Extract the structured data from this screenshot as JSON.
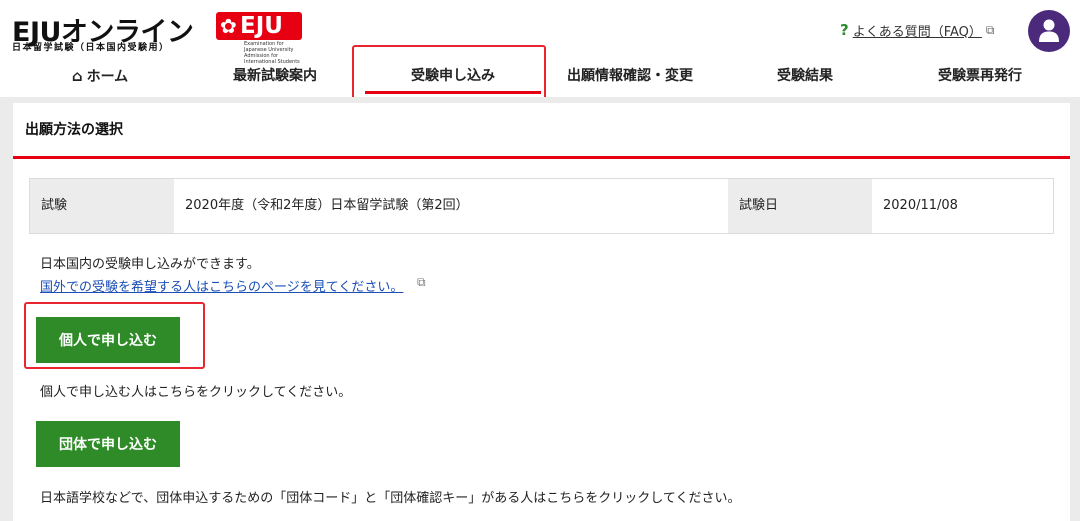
{
  "header": {
    "logo_main": "EJUオンライン",
    "logo_badge": "EJU",
    "logo_sub": "日本留学試験（日本国内受験用）",
    "logo_caption": "Examination for Japanese University Admission for International Students",
    "faq_mark": "?",
    "faq_label": "よくある質問（FAQ）"
  },
  "nav": {
    "home": "ホーム",
    "latest": "最新試験案内",
    "apply": "受験申し込み",
    "confirm": "出願情報確認・変更",
    "results": "受験結果",
    "reissue": "受験票再発行"
  },
  "page": {
    "title": "出願方法の選択"
  },
  "exam_info": {
    "exam_label": "試験",
    "exam_value": "2020年度（令和2年度）日本留学試験（第2回）",
    "date_label": "試験日",
    "date_value": "2020/11/08"
  },
  "content": {
    "description": "日本国内の受験申し込みができます。",
    "abroad_link": "国外での受験を希望する人はこちらのページを見てください。",
    "individual_button": "個人で申し込む",
    "individual_note": "個人で申し込む人はこちらをクリックしてください。",
    "group_button": "団体で申し込む",
    "group_note": "日本語学校などで、団体申込するための「団体コード」と「団体確認キー」がある人はこちらをクリックしてください。"
  },
  "colors": {
    "brand_red": "#e60012",
    "button_green": "#2e8b27",
    "avatar_purple": "#4b2a7b",
    "link_blue": "#1a4fb5"
  }
}
